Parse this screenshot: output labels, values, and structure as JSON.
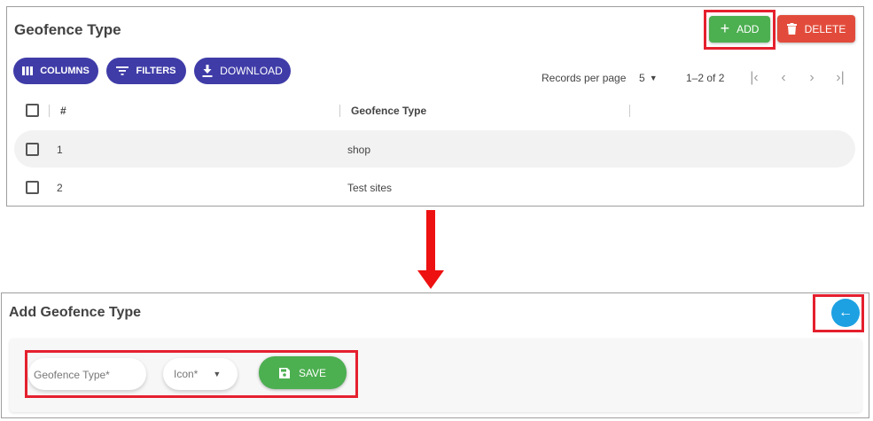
{
  "list_view": {
    "title": "Geofence Type",
    "add_label": "ADD",
    "delete_label": "DELETE",
    "columns_label": "COLUMNS",
    "filters_label": "FILTERS",
    "download_label": "DOWNLOAD",
    "records_per_page_label": "Records per page",
    "records_per_page_value": "5",
    "range_text": "1–2 of 2",
    "table": {
      "headers": [
        "#",
        "Geofence Type"
      ],
      "rows": [
        {
          "id": "1",
          "type": "shop"
        },
        {
          "id": "2",
          "type": "Test sites"
        }
      ]
    }
  },
  "add_view": {
    "title": "Add Geofence Type",
    "geofence_type_placeholder": "Geofence Type*",
    "icon_placeholder": "Icon*",
    "save_label": "SAVE"
  },
  "colors": {
    "add_green": "#4caf50",
    "delete_red": "#e24b3b",
    "pill_indigo": "#3f3ca8",
    "back_blue": "#1da1e2",
    "highlight_red": "#e5202e"
  }
}
